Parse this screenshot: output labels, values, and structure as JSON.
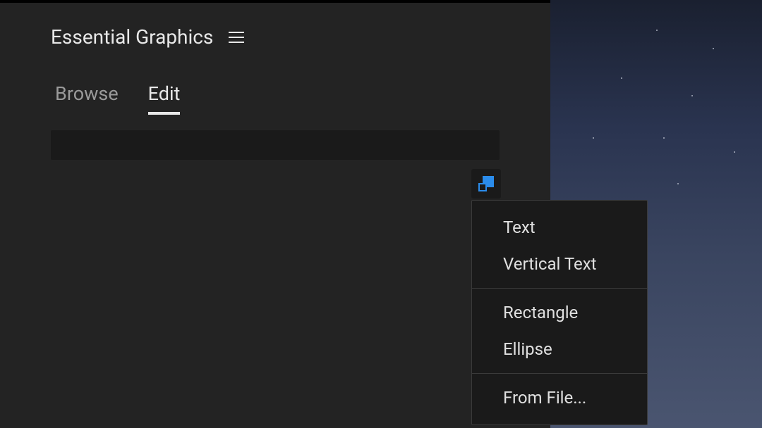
{
  "panel": {
    "title": "Essential Graphics",
    "tabs": {
      "browse": "Browse",
      "edit": "Edit"
    }
  },
  "menu": {
    "items": {
      "text": "Text",
      "vertical_text": "Vertical Text",
      "rectangle": "Rectangle",
      "ellipse": "Ellipse",
      "from_file": "From File..."
    }
  }
}
